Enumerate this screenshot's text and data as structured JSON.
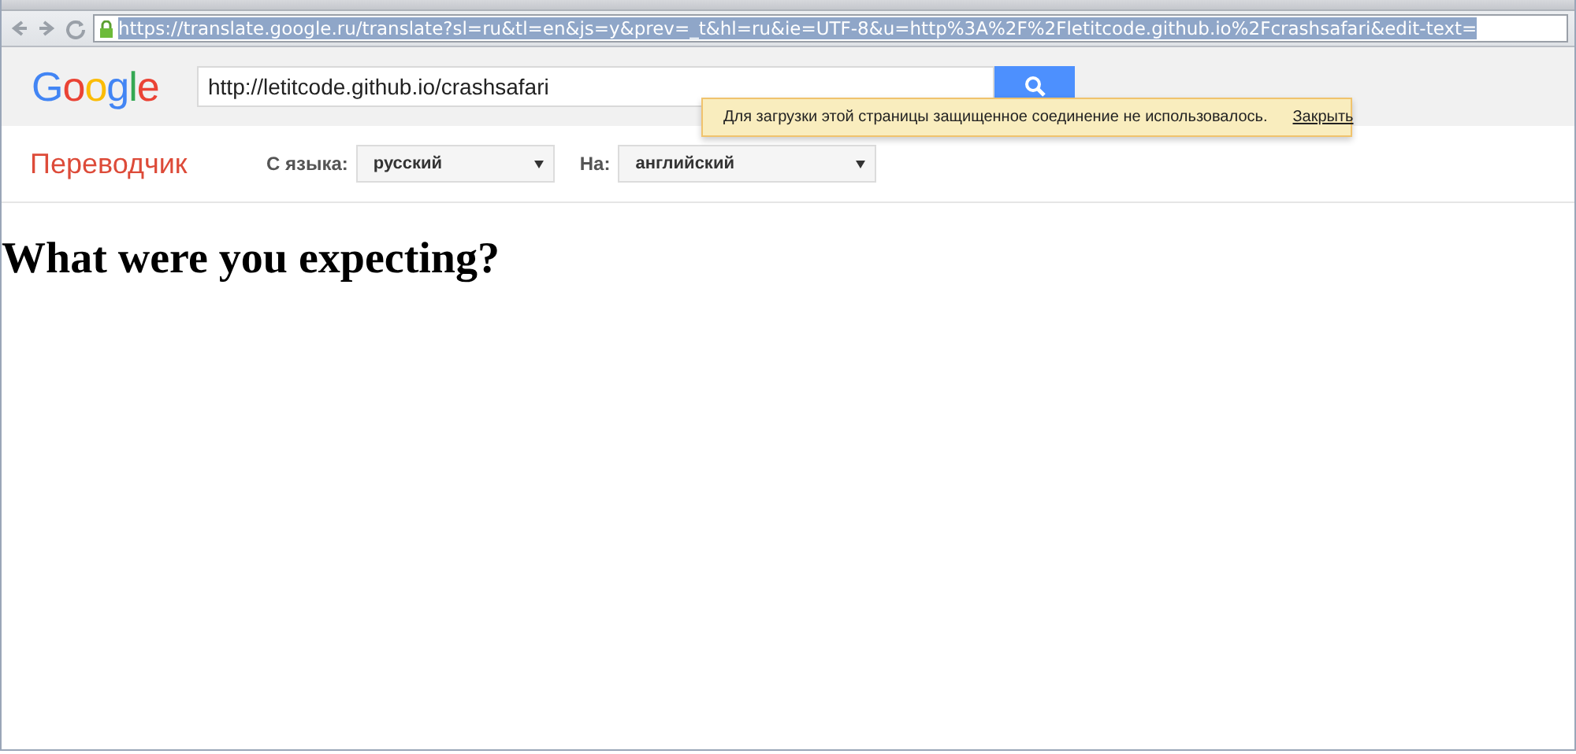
{
  "browser": {
    "address": "https://translate.google.ru/translate?sl=ru&tl=en&js=y&prev=_t&hl=ru&ie=UTF-8&u=http%3A%2F%2Fletitcode.github.io%2Fcrashsafari&edit-text=",
    "address_selected": true
  },
  "header": {
    "logo": "Google",
    "search_value": "http://letitcode.github.io/crashsafari"
  },
  "notice": {
    "text": "Для загрузки этой страницы защищенное соединение не использовалось.",
    "link": "Закрыть"
  },
  "translator": {
    "title": "Переводчик",
    "from_label": "С языка:",
    "from_value": "русский",
    "to_label": "На:",
    "to_value": "английский"
  },
  "page": {
    "heading": "What were you expecting?"
  }
}
